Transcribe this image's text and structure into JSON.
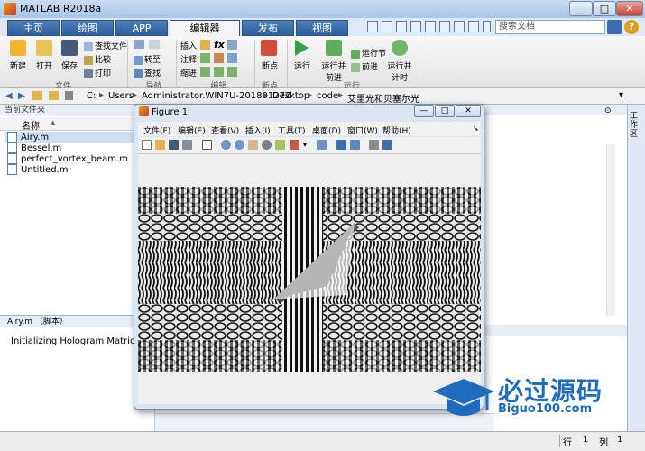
{
  "window": {
    "title": "MATLAB R2018a",
    "minimize": "_",
    "maximize": "□",
    "close": "✕"
  },
  "tabs": [
    {
      "label": "主页",
      "active": false
    },
    {
      "label": "绘图",
      "active": false
    },
    {
      "label": "APP",
      "active": false
    },
    {
      "label": "编辑器",
      "active": true
    },
    {
      "label": "发布",
      "active": false
    },
    {
      "label": "视图",
      "active": false
    }
  ],
  "search": {
    "placeholder": "搜索文档"
  },
  "help": {
    "label": "?"
  },
  "ribbon": {
    "file": {
      "new": "新建",
      "open": "打开",
      "save": "保存",
      "find_files": "查找文件",
      "compare": "比较",
      "print": "打印",
      "group": "文件"
    },
    "navigate": {
      "goto": "转至",
      "find": "查找",
      "group": "导航"
    },
    "edit": {
      "insert": "插入",
      "comment": "注释",
      "indent": "缩进",
      "fx": "fx",
      "group": "编辑"
    },
    "breakpoints": {
      "label": "断点",
      "group": "断点"
    },
    "run": {
      "run": "运行",
      "run_advance_1": "运行并",
      "run_advance_2": "前进",
      "run_section": "运行节",
      "advance": "前进",
      "run_time_1": "运行并",
      "run_time_2": "计时",
      "group": "运行"
    }
  },
  "address": {
    "drive": "C:",
    "parts": [
      "Users",
      "Administrator.WIN7U-20180127Z",
      "Desktop",
      "code",
      "艾里光和贝塞尔光"
    ]
  },
  "current_folder": {
    "title": "当前文件夹",
    "column": "名称",
    "sort_indicator": "▲",
    "files": [
      "Airy.m",
      "Bessel.m",
      "perfect_vortex_beam.m",
      "Untitled.m"
    ],
    "selected": 0
  },
  "details": {
    "header": "Airy.m （脚本）",
    "body": "Initializing Hologram Matrices"
  },
  "workspace_label": "工作区",
  "status": {
    "row_label": "行",
    "row": "1",
    "col_label": "列",
    "col": "1"
  },
  "figure": {
    "title": "Figure 1",
    "menus": [
      "文件(F)",
      "编辑(E)",
      "查看(V)",
      "插入(I)",
      "工具(T)",
      "桌面(D)",
      "窗口(W)",
      "帮助(H)"
    ],
    "controls": {
      "minimize": "—",
      "maximize": "□",
      "close": "✕"
    }
  },
  "watermark": {
    "main": "必过源码",
    "sub": "Biguo100.com"
  },
  "colors": {
    "accent": "#2f5f9c",
    "watermark": "#1f6bbd",
    "selection": "#cfe0f5"
  }
}
